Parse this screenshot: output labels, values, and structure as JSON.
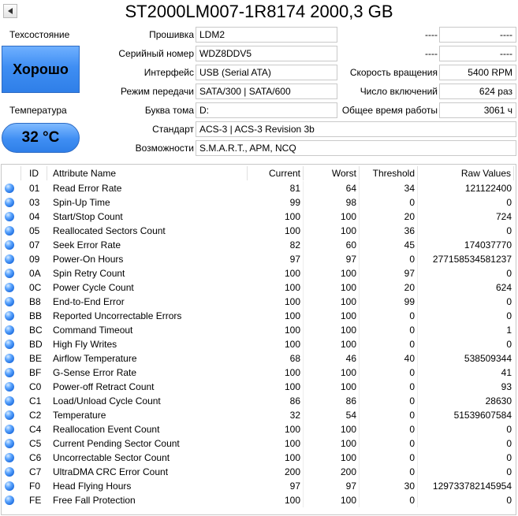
{
  "title": "ST2000LM007-1R8174 2000,3 GB",
  "health": {
    "label": "Техсостояние",
    "value": "Хорошо",
    "color": "#3f8ef3"
  },
  "temperature": {
    "label": "Температура",
    "value": "32 °C"
  },
  "info_left": [
    {
      "label": "Прошивка",
      "value": "LDM2"
    },
    {
      "label": "Серийный номер",
      "value": "WDZ8DDV5"
    },
    {
      "label": "Интерфейс",
      "value": "USB (Serial ATA)"
    },
    {
      "label": "Режим передачи",
      "value": "SATA/300 | SATA/600"
    },
    {
      "label": "Буква тома",
      "value": "D:"
    }
  ],
  "info_right": [
    {
      "label": "----",
      "value": "----"
    },
    {
      "label": "----",
      "value": "----"
    },
    {
      "label": "Скорость вращения",
      "value": "5400 RPM"
    },
    {
      "label": "Число включений",
      "value": "624 раз"
    },
    {
      "label": "Общее время работы",
      "value": "3061 ч"
    }
  ],
  "standard": {
    "label": "Стандарт",
    "value": "ACS-3 | ACS-3 Revision 3b"
  },
  "features": {
    "label": "Возможности",
    "value": "S.M.A.R.T., APM, NCQ"
  },
  "table": {
    "columns": [
      "ID",
      "Attribute Name",
      "Current",
      "Worst",
      "Threshold",
      "Raw Values"
    ],
    "rows": [
      [
        "01",
        "Read Error Rate",
        "81",
        "64",
        "34",
        "121122400"
      ],
      [
        "03",
        "Spin-Up Time",
        "99",
        "98",
        "0",
        "0"
      ],
      [
        "04",
        "Start/Stop Count",
        "100",
        "100",
        "20",
        "724"
      ],
      [
        "05",
        "Reallocated Sectors Count",
        "100",
        "100",
        "36",
        "0"
      ],
      [
        "07",
        "Seek Error Rate",
        "82",
        "60",
        "45",
        "174037770"
      ],
      [
        "09",
        "Power-On Hours",
        "97",
        "97",
        "0",
        "277158534581237"
      ],
      [
        "0A",
        "Spin Retry Count",
        "100",
        "100",
        "97",
        "0"
      ],
      [
        "0C",
        "Power Cycle Count",
        "100",
        "100",
        "20",
        "624"
      ],
      [
        "B8",
        "End-to-End Error",
        "100",
        "100",
        "99",
        "0"
      ],
      [
        "BB",
        "Reported Uncorrectable Errors",
        "100",
        "100",
        "0",
        "0"
      ],
      [
        "BC",
        "Command Timeout",
        "100",
        "100",
        "0",
        "1"
      ],
      [
        "BD",
        "High Fly Writes",
        "100",
        "100",
        "0",
        "0"
      ],
      [
        "BE",
        "Airflow Temperature",
        "68",
        "46",
        "40",
        "538509344"
      ],
      [
        "BF",
        "G-Sense Error Rate",
        "100",
        "100",
        "0",
        "41"
      ],
      [
        "C0",
        "Power-off Retract Count",
        "100",
        "100",
        "0",
        "93"
      ],
      [
        "C1",
        "Load/Unload Cycle Count",
        "86",
        "86",
        "0",
        "28630"
      ],
      [
        "C2",
        "Temperature",
        "32",
        "54",
        "0",
        "51539607584"
      ],
      [
        "C4",
        "Reallocation Event Count",
        "100",
        "100",
        "0",
        "0"
      ],
      [
        "C5",
        "Current Pending Sector Count",
        "100",
        "100",
        "0",
        "0"
      ],
      [
        "C6",
        "Uncorrectable Sector Count",
        "100",
        "100",
        "0",
        "0"
      ],
      [
        "C7",
        "UltraDMA CRC Error Count",
        "200",
        "200",
        "0",
        "0"
      ],
      [
        "F0",
        "Head Flying Hours",
        "97",
        "97",
        "30",
        "129733782145954"
      ],
      [
        "FE",
        "Free Fall Protection",
        "100",
        "100",
        "0",
        "0"
      ]
    ]
  }
}
